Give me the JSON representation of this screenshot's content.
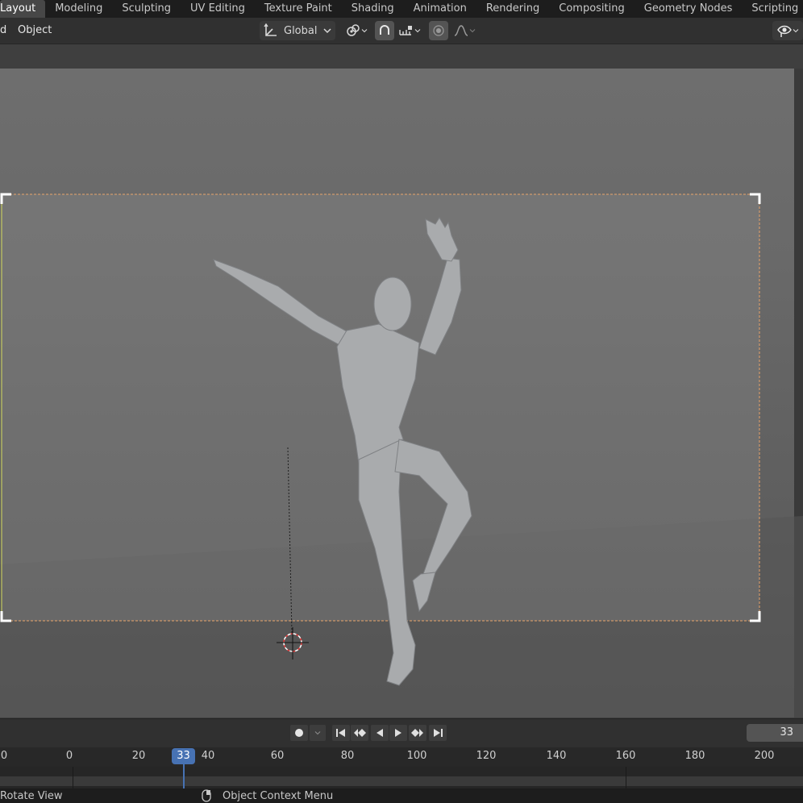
{
  "workspace_tabs": [
    {
      "label": "Layout",
      "active": true
    },
    {
      "label": "Modeling"
    },
    {
      "label": "Sculpting"
    },
    {
      "label": "UV Editing"
    },
    {
      "label": "Texture Paint"
    },
    {
      "label": "Shading"
    },
    {
      "label": "Animation"
    },
    {
      "label": "Rendering"
    },
    {
      "label": "Compositing"
    },
    {
      "label": "Geometry Nodes"
    },
    {
      "label": "Scripting"
    }
  ],
  "add_tab_symbol": "+",
  "header": {
    "menu_partial": "d",
    "menu_object": "Object",
    "transform_orientation": "Global",
    "transform_icon": "transform-orientation-icon",
    "pivot_icon": "pivot-point-icon",
    "snap_icon": "snap-magnet-icon",
    "snap_target_icon": "snap-increment-icon",
    "proportional_icon": "proportional-edit-icon",
    "falloff_icon": "falloff-curve-icon",
    "visibility_icon": "eye-icon"
  },
  "timeline": {
    "current_frame": "33",
    "frame_field": "33",
    "ruler_ticks": [
      "0",
      "0",
      "20",
      "40",
      "60",
      "80",
      "100",
      "120",
      "140",
      "160",
      "180",
      "200"
    ],
    "keyframe_icon": "record-keyframe-icon"
  },
  "statusbar": {
    "left_hint": "Rotate View",
    "mid_hint": "Object Context Menu"
  },
  "colors": {
    "accent_blue": "#4772b3",
    "camera_frame": "#e8a36a",
    "cursor_red": "#e83a3a"
  }
}
